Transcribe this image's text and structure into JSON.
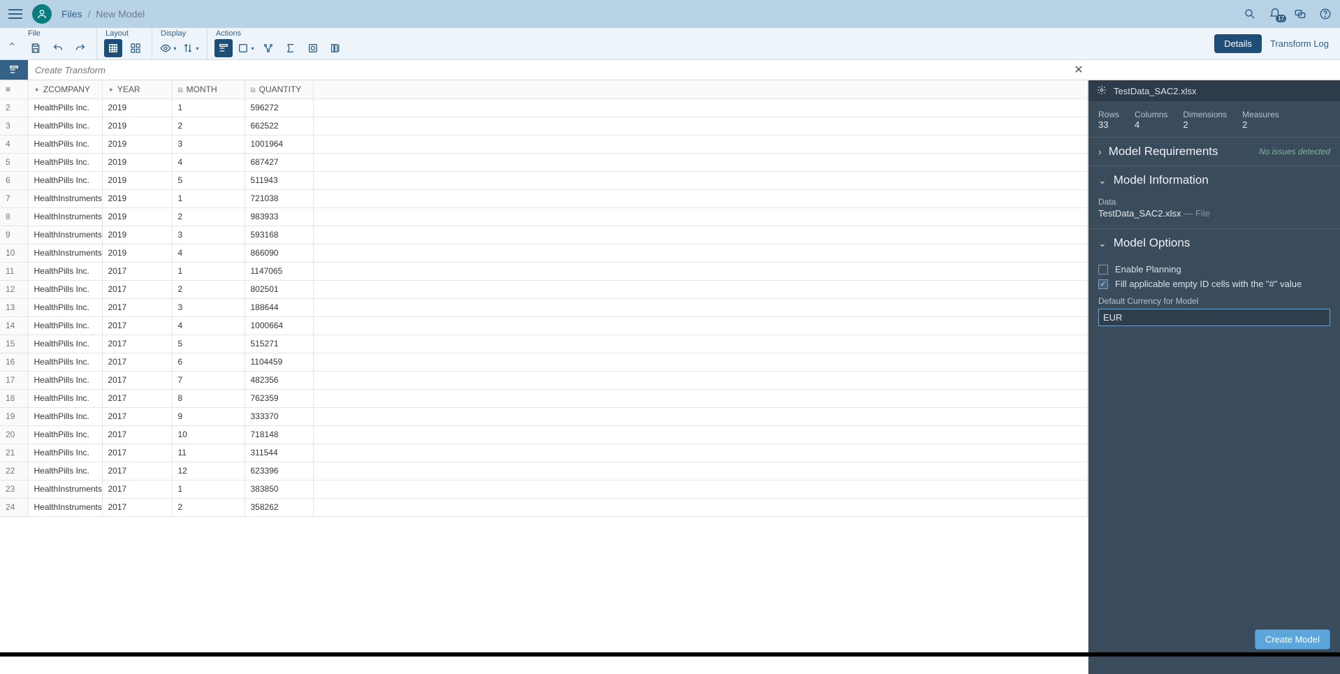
{
  "shell": {
    "breadcrumb": {
      "root": "Files",
      "current": "New Model"
    },
    "notif_count": "17"
  },
  "toolbar": {
    "file": "File",
    "layout": "Layout",
    "display": "Display",
    "actions": "Actions",
    "details": "Details",
    "transform_log": "Transform Log"
  },
  "transform": {
    "placeholder": "Create Transform"
  },
  "grid": {
    "columns": [
      "ZCOMPANY",
      "YEAR",
      "MONTH",
      "QUANTITY"
    ],
    "rows": [
      {
        "n": "2",
        "c": "HealthPills Inc.",
        "y": "2019",
        "m": "1",
        "q": "596272"
      },
      {
        "n": "3",
        "c": "HealthPills Inc.",
        "y": "2019",
        "m": "2",
        "q": "662522"
      },
      {
        "n": "4",
        "c": "HealthPills Inc.",
        "y": "2019",
        "m": "3",
        "q": "1001964"
      },
      {
        "n": "5",
        "c": "HealthPills Inc.",
        "y": "2019",
        "m": "4",
        "q": "687427"
      },
      {
        "n": "6",
        "c": "HealthPills Inc.",
        "y": "2019",
        "m": "5",
        "q": "511943"
      },
      {
        "n": "7",
        "c": "HealthInstruments",
        "y": "2019",
        "m": "1",
        "q": "721038"
      },
      {
        "n": "8",
        "c": "HealthInstruments",
        "y": "2019",
        "m": "2",
        "q": "983933"
      },
      {
        "n": "9",
        "c": "HealthInstruments",
        "y": "2019",
        "m": "3",
        "q": "593168"
      },
      {
        "n": "10",
        "c": "HealthInstruments",
        "y": "2019",
        "m": "4",
        "q": "866090"
      },
      {
        "n": "11",
        "c": "HealthPills Inc.",
        "y": "2017",
        "m": "1",
        "q": "1147065"
      },
      {
        "n": "12",
        "c": "HealthPills Inc.",
        "y": "2017",
        "m": "2",
        "q": "802501"
      },
      {
        "n": "13",
        "c": "HealthPills Inc.",
        "y": "2017",
        "m": "3",
        "q": "188644"
      },
      {
        "n": "14",
        "c": "HealthPills Inc.",
        "y": "2017",
        "m": "4",
        "q": "1000664"
      },
      {
        "n": "15",
        "c": "HealthPills Inc.",
        "y": "2017",
        "m": "5",
        "q": "515271"
      },
      {
        "n": "16",
        "c": "HealthPills Inc.",
        "y": "2017",
        "m": "6",
        "q": "1104459"
      },
      {
        "n": "17",
        "c": "HealthPills Inc.",
        "y": "2017",
        "m": "7",
        "q": "482356"
      },
      {
        "n": "18",
        "c": "HealthPills Inc.",
        "y": "2017",
        "m": "8",
        "q": "762359"
      },
      {
        "n": "19",
        "c": "HealthPills Inc.",
        "y": "2017",
        "m": "9",
        "q": "333370"
      },
      {
        "n": "20",
        "c": "HealthPills Inc.",
        "y": "2017",
        "m": "10",
        "q": "718148"
      },
      {
        "n": "21",
        "c": "HealthPills Inc.",
        "y": "2017",
        "m": "11",
        "q": "311544"
      },
      {
        "n": "22",
        "c": "HealthPills Inc.",
        "y": "2017",
        "m": "12",
        "q": "623396"
      },
      {
        "n": "23",
        "c": "HealthInstruments",
        "y": "2017",
        "m": "1",
        "q": "383850"
      },
      {
        "n": "24",
        "c": "HealthInstruments",
        "y": "2017",
        "m": "2",
        "q": "358262"
      }
    ]
  },
  "inspector": {
    "filename": "TestData_SAC2.xlsx",
    "stats": {
      "rows_lbl": "Rows",
      "rows": "33",
      "cols_lbl": "Columns",
      "cols": "4",
      "dim_lbl": "Dimensions",
      "dim": "2",
      "meas_lbl": "Measures",
      "meas": "2"
    },
    "req": {
      "title": "Model Requirements",
      "aside": "No issues detected"
    },
    "info": {
      "title": "Model Information",
      "data_lbl": "Data",
      "data_val": "TestData_SAC2.xlsx",
      "data_sub": "— File"
    },
    "opts": {
      "title": "Model Options",
      "enable_planning": "Enable Planning",
      "fill_cells": "Fill applicable empty ID cells with the \"#\" value",
      "currency_lbl": "Default Currency for Model",
      "currency_val": "EUR"
    },
    "create": "Create Model"
  }
}
